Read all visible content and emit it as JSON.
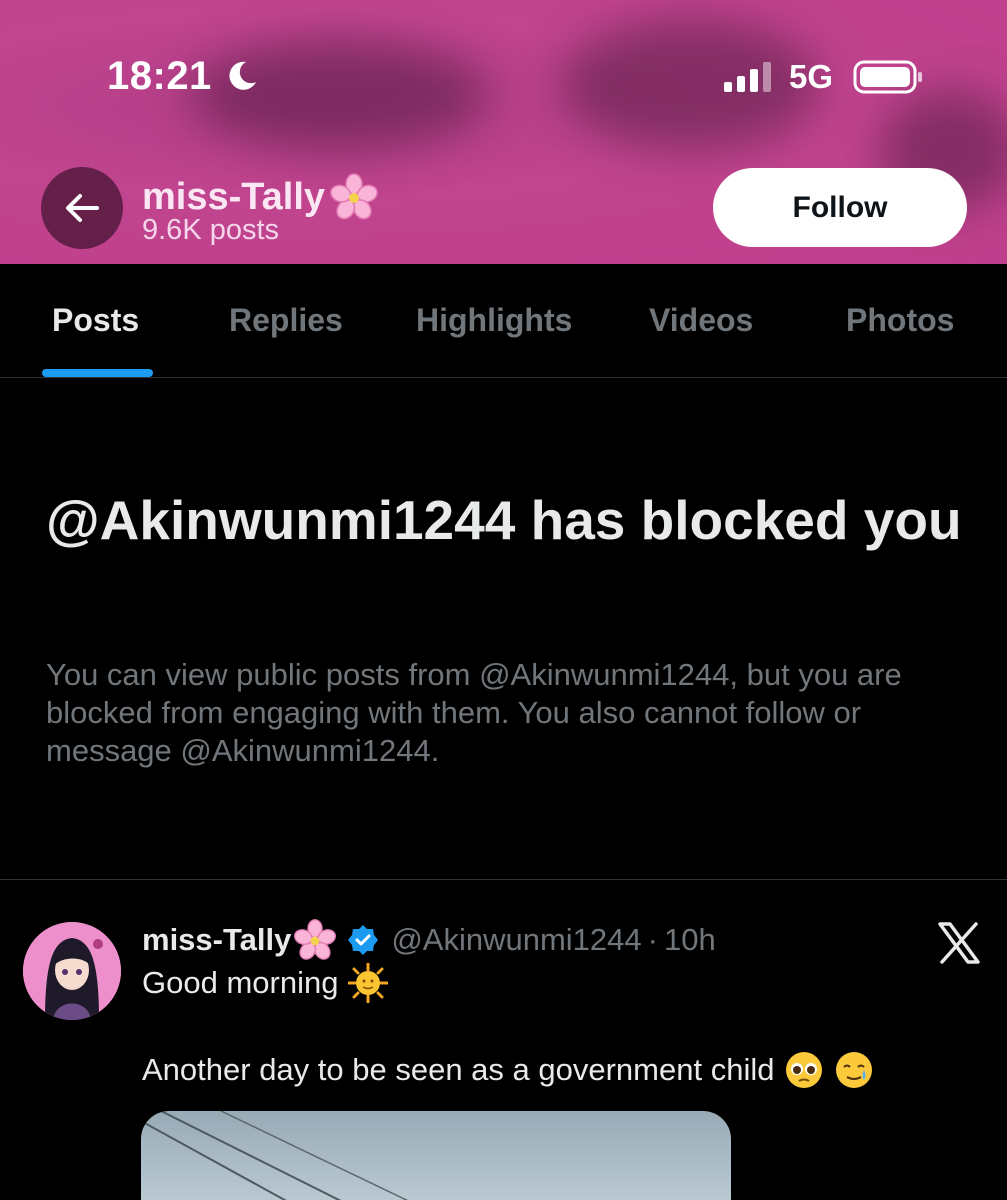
{
  "status_bar": {
    "time": "18:21",
    "network": "5G",
    "icons": [
      "moon-icon",
      "signal-icon",
      "battery-icon"
    ]
  },
  "profile": {
    "name": "miss-Tally",
    "posts_count": "9.6K posts",
    "follow_label": "Follow"
  },
  "tabs": [
    {
      "label": "Posts",
      "active": true
    },
    {
      "label": "Replies",
      "active": false
    },
    {
      "label": "Highlights",
      "active": false
    },
    {
      "label": "Videos",
      "active": false
    },
    {
      "label": "Photos",
      "active": false
    }
  ],
  "blocked": {
    "title": "@Akinwunmi1244 has blocked you",
    "body": "You can view public posts from @Akinwunmi1244, but you are blocked from engaging with them. You also cannot follow or message @Akinwunmi1244."
  },
  "post": {
    "author_name": "miss-Tally",
    "handle": "@Akinwunmi1244",
    "separator": "·",
    "time": "10h",
    "line1": "Good morning",
    "line2": "Another day to be seen as a government child"
  },
  "colors": {
    "banner": "#bf3f8c",
    "accent": "#1d9bf0",
    "muted_text": "#71767b",
    "background": "#000000"
  }
}
